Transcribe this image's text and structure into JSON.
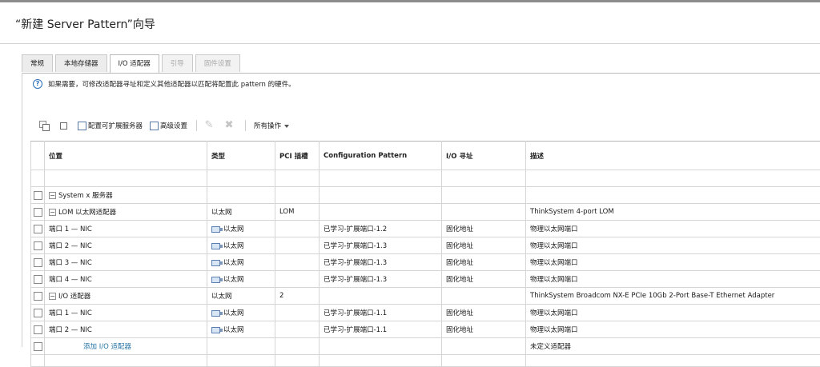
{
  "wizard": {
    "title": "“新建 Server Pattern”向导"
  },
  "tabs": [
    {
      "label": "常规",
      "state": "normal"
    },
    {
      "label": "本地存储器",
      "state": "normal"
    },
    {
      "label": "I/O 适配器",
      "state": "active"
    },
    {
      "label": "引导",
      "state": "disabled"
    },
    {
      "label": "固件设置",
      "state": "disabled"
    }
  ],
  "help": {
    "icon": "help-circle-icon",
    "text": "如果需要，可修改适配器寻址和定义其他适配器以匹配将配置此 pattern 的硬件。"
  },
  "toolbar": {
    "expand_icon": "expand-all-icon",
    "collapse_icon": "collapse-all-icon",
    "config_expand_label": "配置可扩展服务器",
    "advanced_label": "高级设置",
    "edit_icon": "edit-icon",
    "remove_icon": "remove-icon",
    "all_actions_label": "所有操作"
  },
  "table": {
    "headers": [
      "位置",
      "类型",
      "PCI 插槽",
      "Configuration Pattern",
      "I/O 寻址",
      "描述"
    ],
    "rows": [
      {
        "loc": "System x 服务器",
        "type": "",
        "slot": "",
        "pattern": "",
        "addr": "",
        "desc": ""
      },
      {
        "loc": "LOM 以太网适配器",
        "type": "以太网",
        "slot": "LOM",
        "pattern": "",
        "addr": "",
        "desc": "ThinkSystem 4-port LOM"
      },
      {
        "loc": "端口 1 — NIC",
        "type": "以太网",
        "slot": "",
        "pattern": "已学习-扩展端口-1.2",
        "addr": "固化地址",
        "desc": "物理以太网端口"
      },
      {
        "loc": "端口 2 — NIC",
        "type": "以太网",
        "slot": "",
        "pattern": "已学习-扩展端口-1.3",
        "addr": "固化地址",
        "desc": "物理以太网端口"
      },
      {
        "loc": "端口 3 — NIC",
        "type": "以太网",
        "slot": "",
        "pattern": "已学习-扩展端口-1.3",
        "addr": "固化地址",
        "desc": "物理以太网端口"
      },
      {
        "loc": "端口 4 — NIC",
        "type": "以太网",
        "slot": "",
        "pattern": "已学习-扩展端口-1.3",
        "addr": "固化地址",
        "desc": "物理以太网端口"
      },
      {
        "loc": "I/O 适配器",
        "type": "以太网",
        "slot": "2",
        "pattern": "",
        "addr": "",
        "desc": "ThinkSystem Broadcom NX-E PCIe 10Gb 2-Port Base-T Ethernet Adapter"
      },
      {
        "loc": "端口 1 — NIC",
        "type": "以太网",
        "slot": "",
        "pattern": "已学习-扩展端口-1.1",
        "addr": "固化地址",
        "desc": "物理以太网端口"
      },
      {
        "loc": "端口 2 — NIC",
        "type": "以太网",
        "slot": "",
        "pattern": "已学习-扩展端口-1.1",
        "addr": "固化地址",
        "desc": "物理以太网端口"
      },
      {
        "loc": "添加 I/O 适配器",
        "type": "",
        "slot": "",
        "pattern": "",
        "addr": "",
        "desc": "未定义适配器"
      }
    ]
  },
  "colors": {
    "link": "#2775a6",
    "help_icon": "#2a6eb8",
    "border": "#d5d5d5"
  }
}
